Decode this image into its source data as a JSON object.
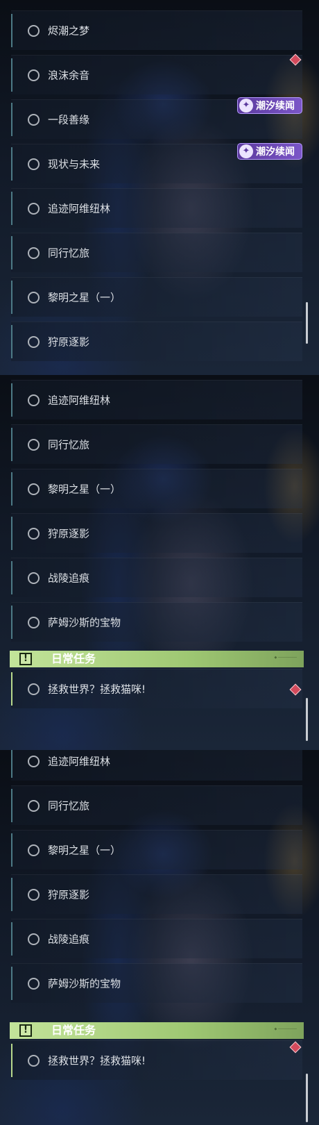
{
  "panel1": {
    "quests": [
      "烬潮之梦",
      "浪沫余音",
      "一段善缘",
      "现状与未来",
      "追迹阿维纽林",
      "同行忆旅",
      "黎明之星（一）",
      "狩原逐影"
    ],
    "badges": [
      "潮汐续闻",
      "潮汐续闻"
    ]
  },
  "panel2": {
    "quests": [
      "追迹阿维纽林",
      "同行忆旅",
      "黎明之星（一）",
      "狩原逐影",
      "战陵追痕",
      "萨姆沙斯的宝物"
    ],
    "daily_header": "日常任务",
    "daily_quest": "拯救世界？拯救猫咪!"
  },
  "panel3": {
    "quests": [
      "追迹阿维纽林",
      "同行忆旅",
      "黎明之星（一）",
      "狩原逐影",
      "战陵追痕",
      "萨姆沙斯的宝物"
    ],
    "daily_header": "日常任务",
    "daily_quest": "拯救世界？拯救猫咪!"
  },
  "icons": {
    "quest_status": "empty-circle-icon",
    "new_marker": "red-diamond-icon",
    "badge_icon": "tide-swirl-icon",
    "daily_icon": "exclamation-box-icon"
  },
  "colors": {
    "accent_bar": "#4d7a86",
    "badge_purple": "#7b56c8",
    "daily_green": "#b2d784",
    "marker_red": "#d34a5c"
  }
}
